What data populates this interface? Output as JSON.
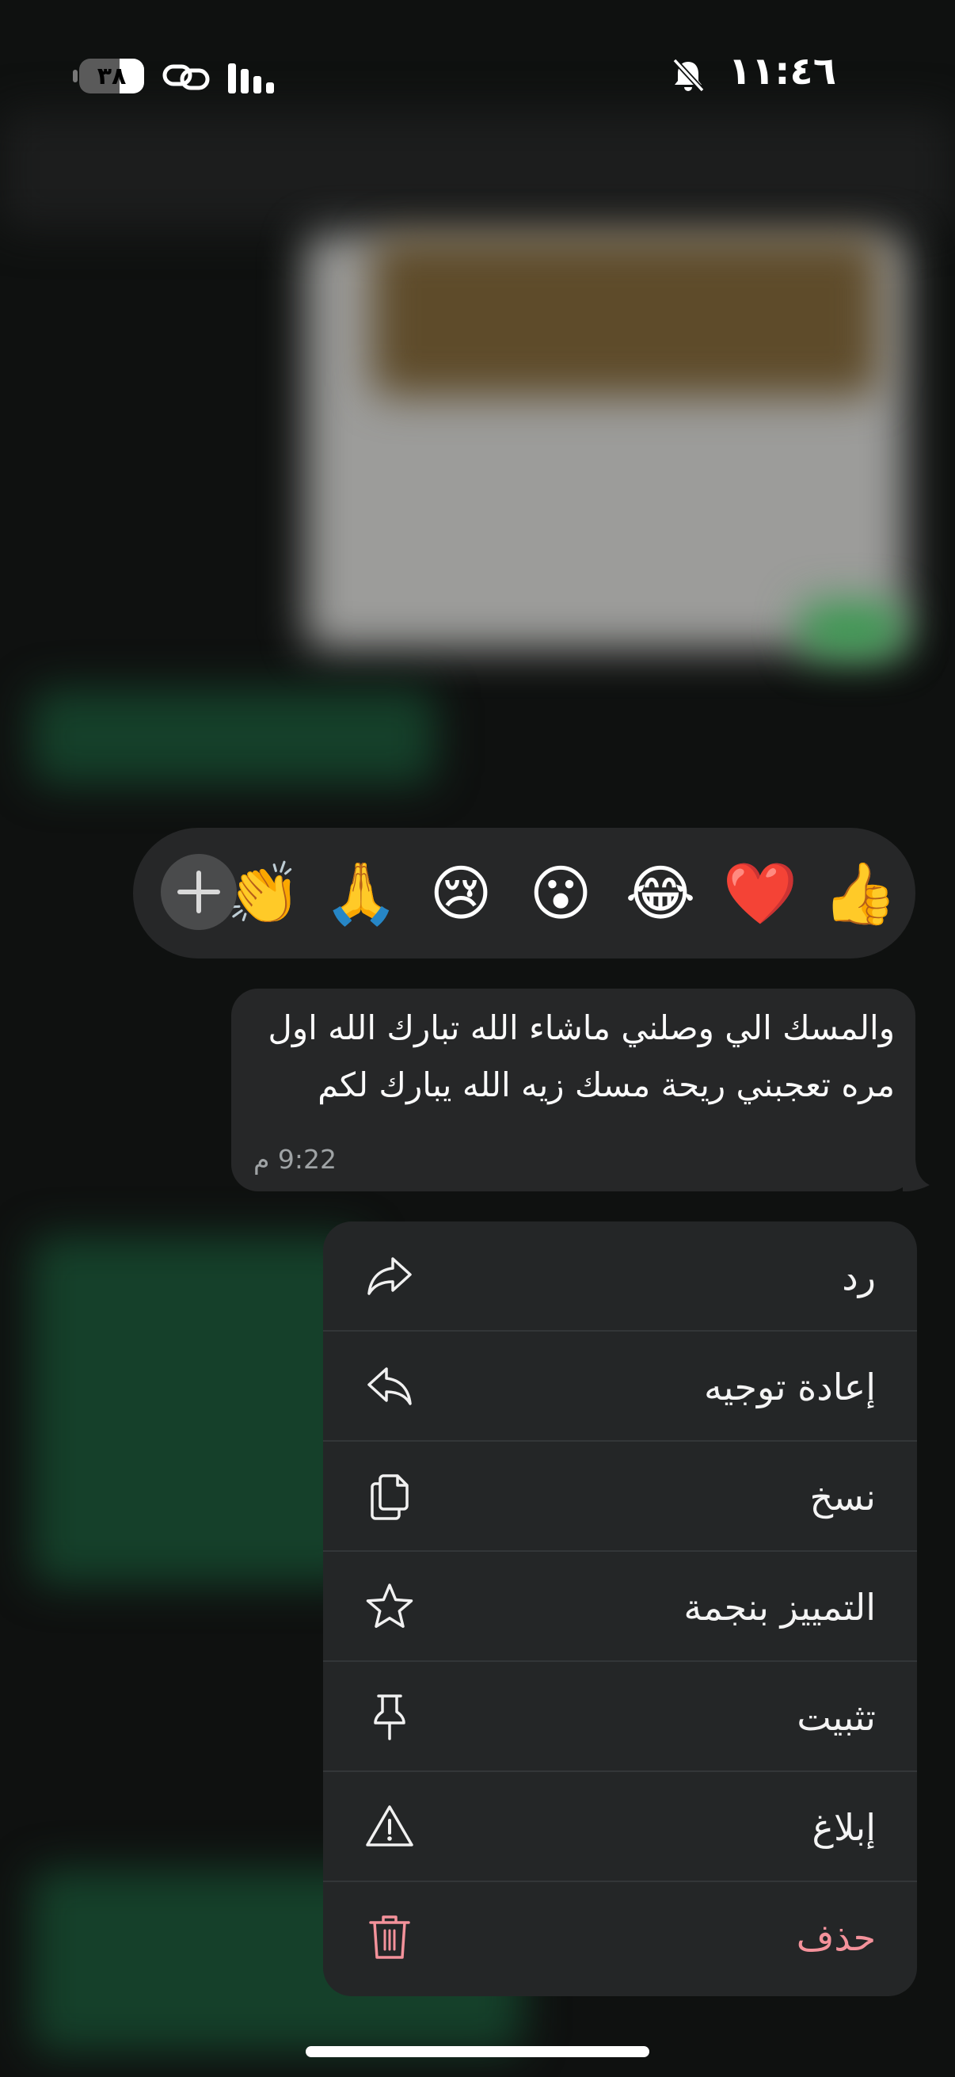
{
  "status_bar": {
    "time": "١١:٤٦",
    "battery_level": "٣٨",
    "battery_fraction": 0.38,
    "icons": [
      "bell-slash-icon",
      "link-icon",
      "signal-bars-icon"
    ]
  },
  "reactions": {
    "emojis": [
      "👍",
      "❤️",
      "😂",
      "😮",
      "😢",
      "🙏",
      "👏"
    ],
    "add_icon": "plus-icon"
  },
  "message": {
    "text": "والمسك الي وصلني ماشاء الله تبارك الله اول مره تعجبني ريحة مسك زيه الله يبارك لكم",
    "time": "9:22 م"
  },
  "menu": {
    "items": [
      {
        "label": "رد",
        "icon": "reply-icon"
      },
      {
        "label": "إعادة توجيه",
        "icon": "forward-icon"
      },
      {
        "label": "نسخ",
        "icon": "copy-icon"
      },
      {
        "label": "التمييز بنجمة",
        "icon": "star-icon"
      },
      {
        "label": "تثبيت",
        "icon": "pin-icon"
      },
      {
        "label": "إبلاغ",
        "icon": "warning-icon"
      },
      {
        "label": "حذف",
        "icon": "trash-icon"
      }
    ],
    "danger_color": "#f4929b"
  }
}
